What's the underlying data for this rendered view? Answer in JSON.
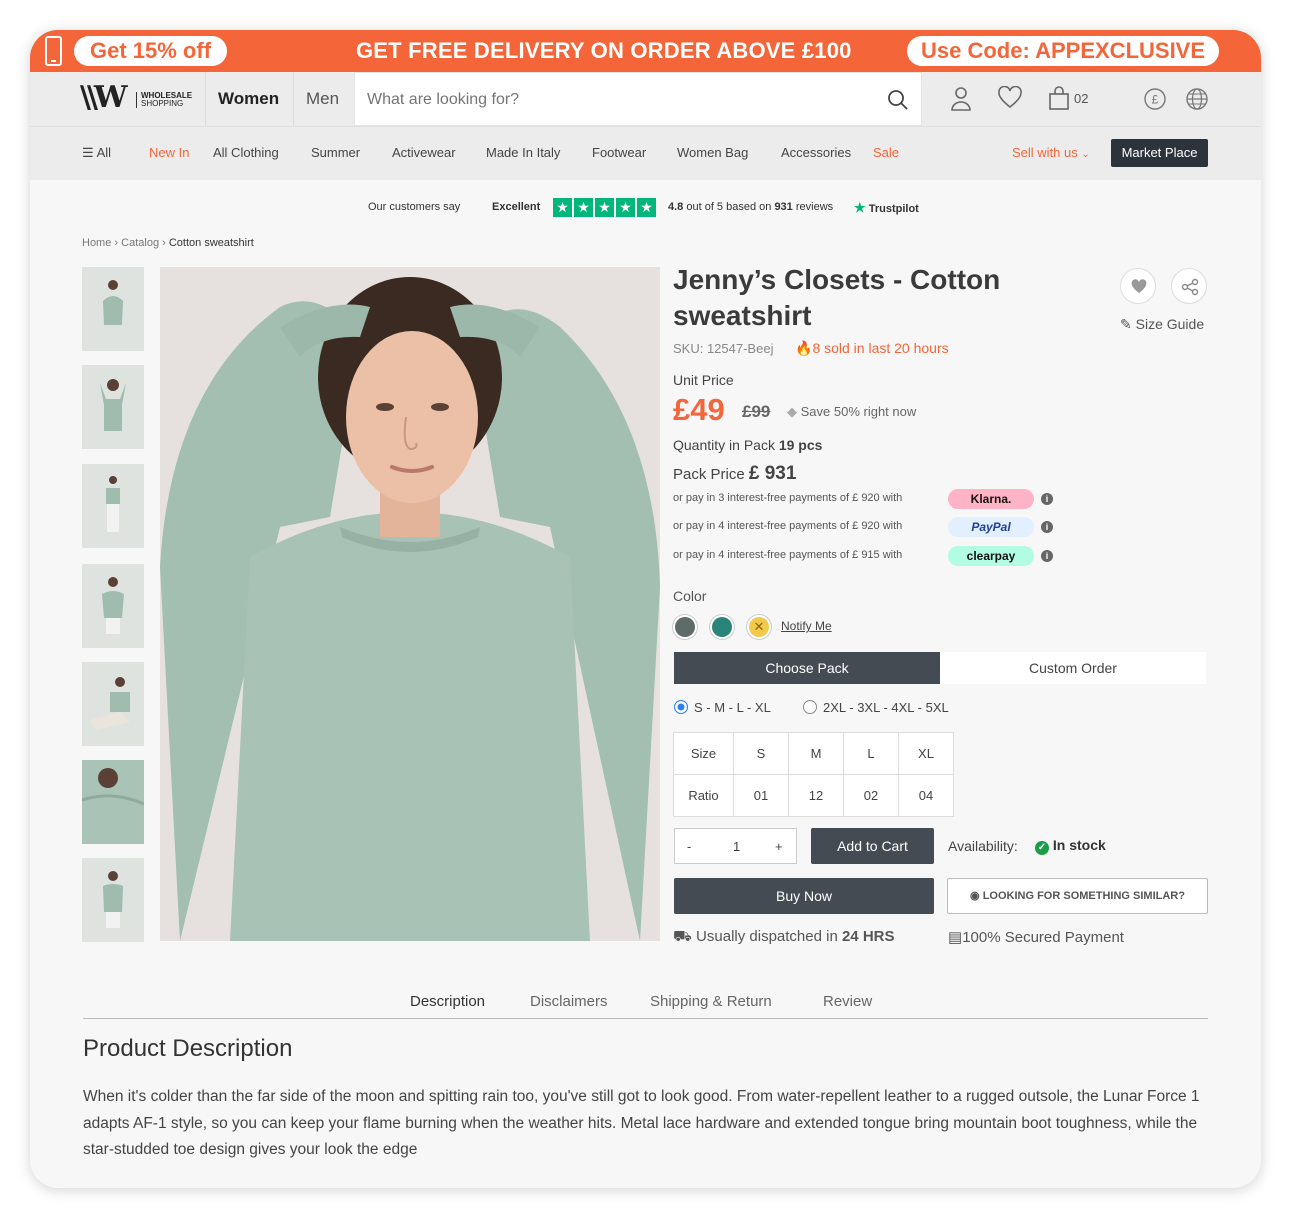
{
  "promo": {
    "left_pill": "Get 15% off",
    "middle": "GET FREE DELIVERY ON ORDER ABOVE £100",
    "right_pill": "Use Code: APPEXCLUSIVE"
  },
  "header": {
    "logo_text_1": "WHOLESALE",
    "logo_text_2": "SHOPPING",
    "tab_women": "Women",
    "tab_men": "Men",
    "search_placeholder": "What are looking for?",
    "cart_count": "02"
  },
  "nav": {
    "all": "All",
    "items": [
      "New In",
      "All Clothing",
      "Summer",
      "Activewear",
      "Made In Italy",
      "Footwear",
      "Women Bag",
      "Accessories",
      "Sale"
    ],
    "sell": "Sell with us",
    "marketplace": "Market Place"
  },
  "trust": {
    "say": "Our customers say",
    "excellent": "Excellent",
    "rating": "4.8",
    "rating_text": "out of 5 based on",
    "reviews": "931",
    "reviews_label": "reviews",
    "brand": "Trustpilot"
  },
  "breadcrumb": [
    "Home",
    "Catalog",
    "Cotton sweatshirt"
  ],
  "product": {
    "title": "Jenny’s Closets - Cotton sweatshirt",
    "size_guide": "Size Guide",
    "sku": "SKU: 12547-Beej",
    "sold": "8 sold in last 20 hours",
    "unit_price_label": "Unit Price",
    "price": "£49",
    "old_price": "£99",
    "save": "Save 50% right now",
    "qty_label": "Quantity in Pack",
    "qty_value": "19 pcs",
    "pack_label": "Pack Price",
    "pack_value": "£ 931",
    "payments": [
      {
        "text": "or pay in 3 interest-free payments of £ 920 with",
        "provider": "Klarna.",
        "bg": "#ffb3c7",
        "fg": "#17120f"
      },
      {
        "text": "or pay in 4 interest-free payments of £ 920 with",
        "provider": "PayPal",
        "bg": "#e2efff",
        "fg": "#1f3f99"
      },
      {
        "text": "or pay in 4 interest-free payments of £ 915 with",
        "provider": "clearpay",
        "bg": "#b2fce4",
        "fg": "#111"
      }
    ],
    "color_label": "Color",
    "colors": [
      "#5e6b68",
      "#2a8477",
      "#f2c94c"
    ],
    "notify": "Notify Me",
    "choose_pack": "Choose Pack",
    "custom_order": "Custom Order",
    "option_1": "S - M - L - XL",
    "option_2": "2XL - 3XL - 4XL - 5XL",
    "size_table": {
      "row1": [
        "Size",
        "S",
        "M",
        "L",
        "XL"
      ],
      "row2": [
        "Ratio",
        "01",
        "12",
        "02",
        "04"
      ]
    },
    "qty_minus": "-",
    "qty_value_input": "1",
    "qty_plus": "+",
    "add_to_cart": "Add to Cart",
    "availability_label": "Availability:",
    "availability_value": "In stock",
    "buy_now": "Buy Now",
    "similar": "LOOKING FOR SOMETHING SIMILAR?",
    "dispatch_pre": "Usually dispatched in",
    "dispatch_bold": "24 HRS",
    "secured": "100% Secured Payment"
  },
  "tabs": [
    "Description",
    "Disclaimers",
    "Shipping & Return",
    "Review"
  ],
  "description": {
    "title": "Product Description",
    "body": "When it's colder than the far side of the moon and spitting rain too, you've still got to look good. From water-repellent leather to a rugged outsole, the Lunar Force 1 adapts AF-1 style, so you can keep your flame burning when the weather hits. Metal lace hardware and extended tongue bring mountain boot toughness, while the star-studded toe design gives your look the edge"
  },
  "colors": {
    "accent": "#f4663a",
    "dark": "#454b53",
    "trustpilot": "#00b67a",
    "stock": "#1a9c4a"
  }
}
